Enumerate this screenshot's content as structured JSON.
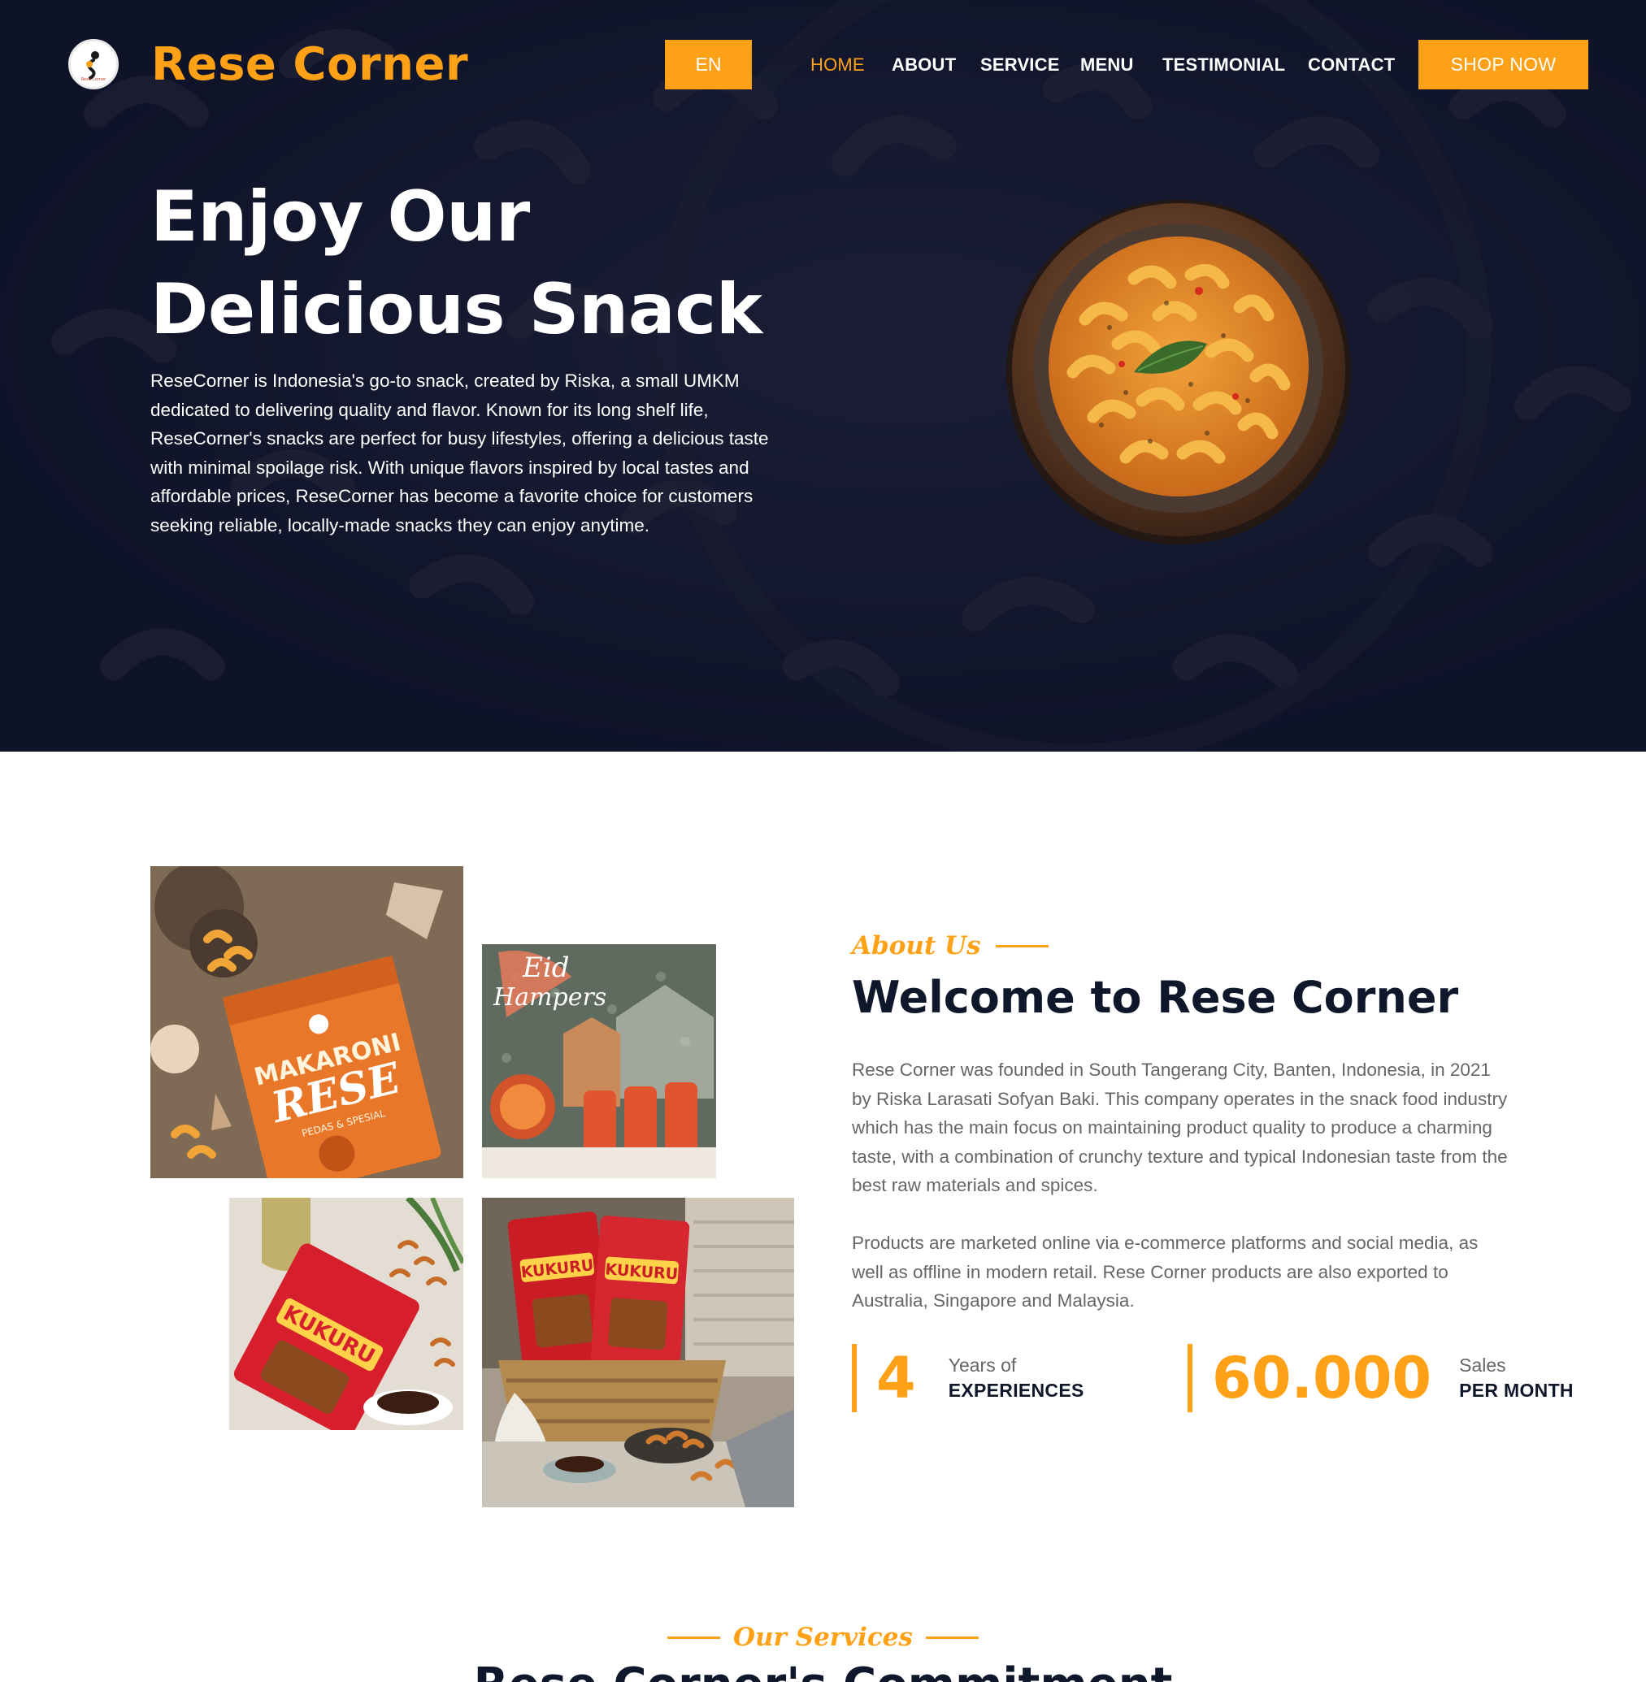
{
  "brand": {
    "name": "Rese Corner",
    "logo_text": "Rese Corner"
  },
  "header": {
    "lang_label": "EN",
    "nav": [
      "HOME",
      "ABOUT",
      "SERVICE",
      "MENU",
      "TESTIMONIAL",
      "CONTACT"
    ],
    "active_nav": "HOME",
    "shop_label": "SHOP NOW"
  },
  "hero": {
    "title_line1": "Enjoy Our",
    "title_line2": "Delicious Snack",
    "text": "ReseCorner is Indonesia's go-to snack, created by Riska, a small UMKM dedicated to delivering quality and flavor. Known for its long shelf life, ReseCorner's snacks are perfect for busy lifestyles, offering a delicious taste with minimal spoilage risk. With unique flavors inspired by local tastes and affordable prices, ReseCorner has become a favorite choice for customers seeking reliable, locally-made snacks they can enjoy anytime."
  },
  "about": {
    "subtitle": "About Us",
    "title": "Welcome to Rese Corner",
    "paragraph1": "Rese Corner was founded in South Tangerang City, Banten, Indonesia, in 2021 by Riska Larasati Sofyan Baki. This company operates in the snack food industry which has the main focus on maintaining product quality to produce a charming taste, with a combination of crunchy texture and typical Indonesian taste from the best raw materials and spices.",
    "paragraph2": "Products are marketed online via e-commerce platforms and social media, as well as offline in modern retail. Rese Corner products are also exported to Australia, Singapore and Malaysia.",
    "stats": [
      {
        "number": "4",
        "top": "Years of",
        "bottom": "EXPERIENCES"
      },
      {
        "number": "60.000",
        "top": "Sales",
        "bottom": "PER MONTH"
      }
    ],
    "photos": {
      "makaroni": {
        "brand": "MAKARONI",
        "name": "RESE",
        "tag": "PEDAS & SPESIAL"
      },
      "hampers": {
        "line1": "Eid",
        "line2": "Hampers"
      },
      "kukuru": "KUKURU"
    }
  },
  "services": {
    "subtitle": "Our Services",
    "title": "Rese Corner's Commitment"
  },
  "colors": {
    "accent": "#fea116",
    "dark": "#0f172b",
    "hero_bg": "#121830",
    "text_muted": "#666666"
  }
}
